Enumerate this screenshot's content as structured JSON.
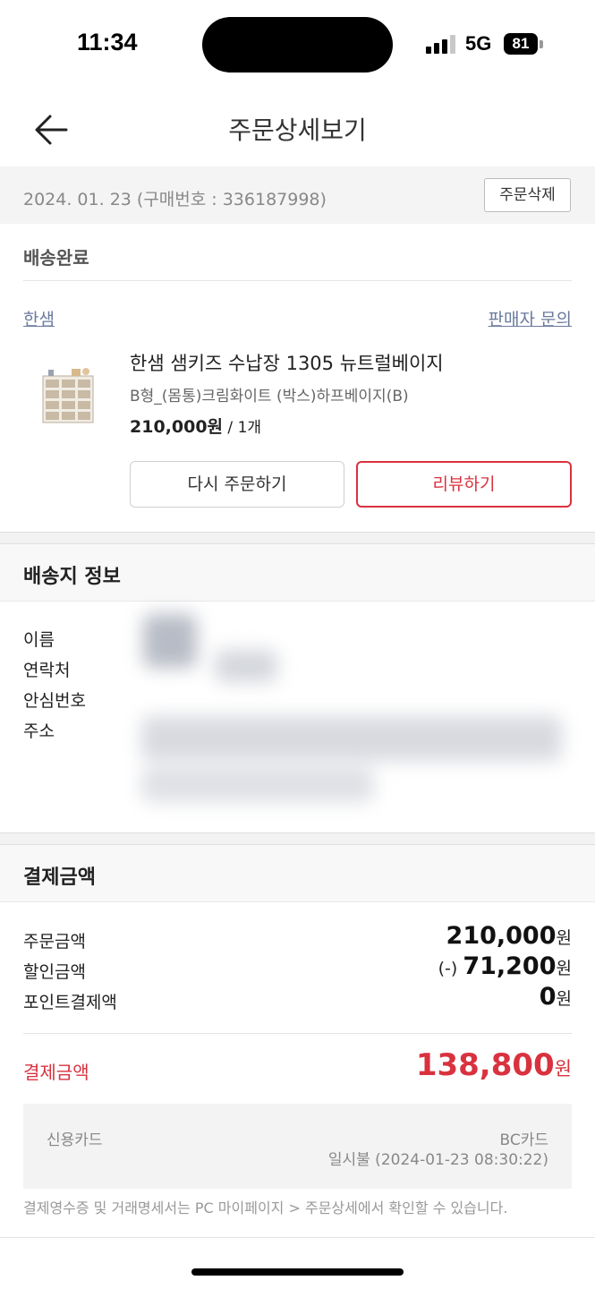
{
  "status_bar": {
    "time": "11:34",
    "network": "5G",
    "battery": "81"
  },
  "header": {
    "title": "주문상세보기",
    "back_icon": "arrow-left-icon"
  },
  "order": {
    "meta": "2024. 01. 23 (구매번호 : 336187998)",
    "delete_label": "주문삭제",
    "status": "배송완료",
    "seller": "한샘",
    "inquiry_label": "판매자 문의",
    "product": {
      "name": "한샘 샘키즈 수납장 1305 뉴트럴베이지",
      "option": "B형_(몸통)크림화이트 (박스)하프베이지(B)",
      "price": "210,000원",
      "quantity": " / 1개"
    },
    "reorder_label": "다시 주문하기",
    "review_label": "리뷰하기"
  },
  "shipping": {
    "title": "배송지 정보",
    "labels": {
      "name": "이름",
      "contact": "연락처",
      "safe_number": "안심번호",
      "address": "주소"
    }
  },
  "payment": {
    "title": "결제금액",
    "rows": {
      "order_amount": {
        "label": "주문금액",
        "prefix": "",
        "value": "210,000",
        "unit": "원"
      },
      "discount": {
        "label": "할인금액",
        "prefix": "(-) ",
        "value": "71,200",
        "unit": "원"
      },
      "points": {
        "label": "포인트결제액",
        "prefix": "",
        "value": "0",
        "unit": "원"
      }
    },
    "total": {
      "label": "결제금액",
      "value": "138,800",
      "unit": "원"
    },
    "method": "신용카드",
    "card": "BC카드",
    "detail": "일시불 (2024-01-23 08:30:22)",
    "note": "결제영수증 및 거래명세서는 PC 마이페이지 > 주문상세에서 확인할 수 있습니다."
  },
  "colors": {
    "accent_red": "#d9323f",
    "link": "#6b7a9c"
  }
}
